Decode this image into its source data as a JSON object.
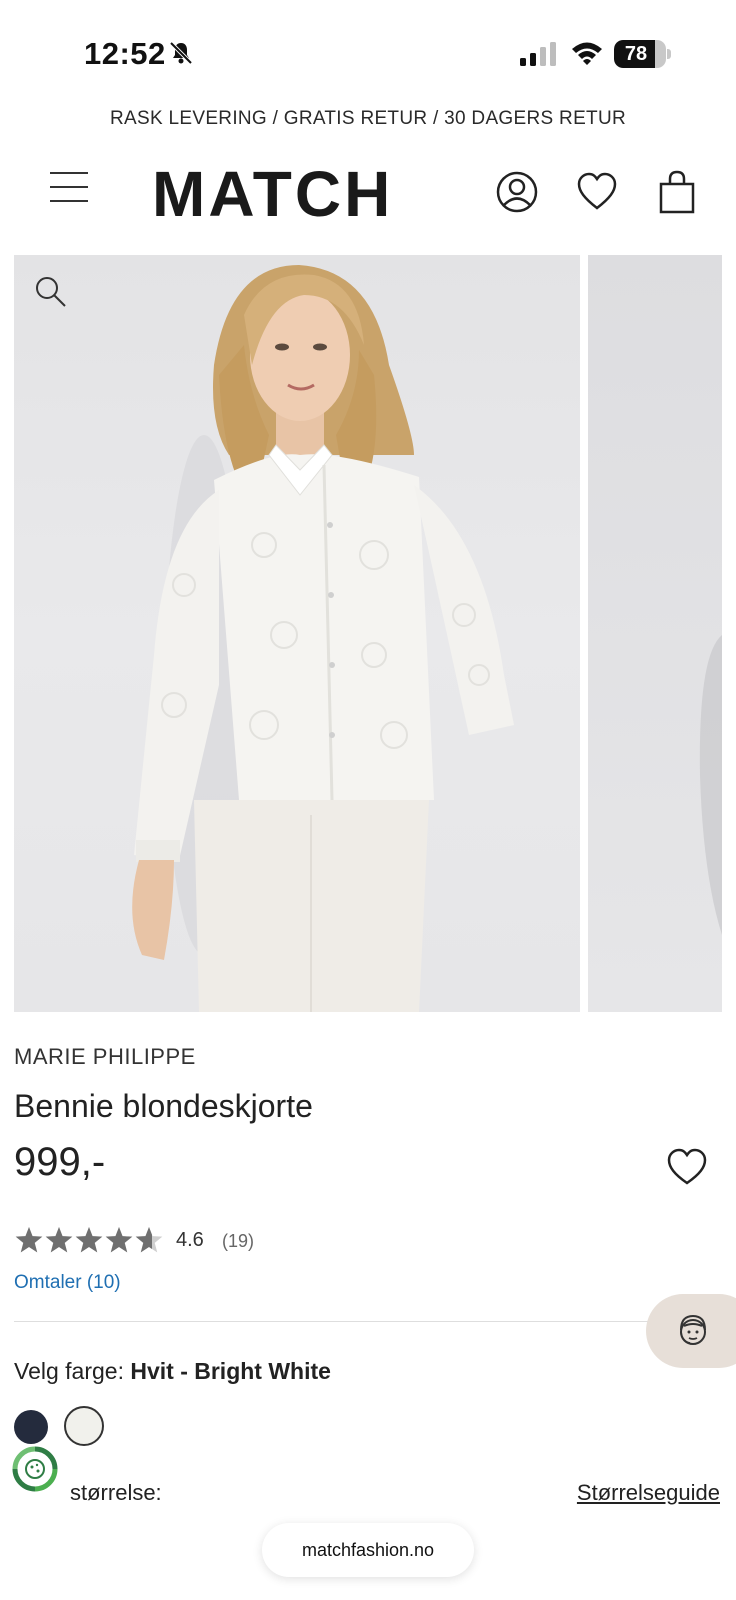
{
  "status_bar": {
    "time": "12:52",
    "battery_percent": "78",
    "battery_level": 0.78,
    "icons": [
      "bell-slash-icon",
      "cellular-signal-icon",
      "wifi-icon",
      "battery-icon"
    ]
  },
  "promo_banner": "RASK LEVERING / GRATIS RETUR / 30 DAGERS RETUR",
  "header": {
    "logo": "MATCH",
    "icons": [
      "hamburger-menu-icon",
      "account-icon",
      "heart-icon",
      "shopping-bag-icon"
    ]
  },
  "gallery": {
    "zoom_icon": "magnifier-icon",
    "image_main": "Model wearing white lace blouse",
    "image_next": "Next product image"
  },
  "product": {
    "brand": "MARIE PHILIPPE",
    "title": "Bennie blondeskjorte",
    "price": "999,-",
    "rating": "4.6",
    "rating_value": 4.6,
    "rating_max": 5,
    "rating_count": "(19)",
    "reviews_link": "Omtaler (10)",
    "color_label": "Velg farge:",
    "color_value": "Hvit - Bright White",
    "swatches": [
      {
        "name": "navy",
        "color": "#242b3d"
      },
      {
        "name": "bright-white",
        "color": "#f1f1ec",
        "selected": true
      }
    ],
    "size_label": "størrelse:",
    "size_guide": "Størrelseguide"
  },
  "colors": {
    "link": "#1f6fb2",
    "support_bg": "#e7dfd8",
    "eco_green": "#2f7d45"
  },
  "browser": {
    "url": "matchfashion.no"
  }
}
